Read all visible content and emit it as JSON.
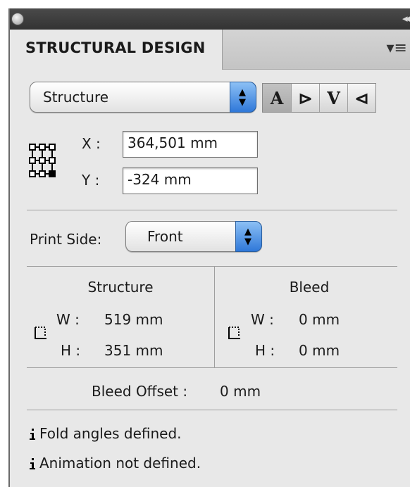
{
  "panel": {
    "tab_title": "STRUCTURAL DESIGN",
    "close_icon": "close-dot-icon",
    "collapse_icon": "double-chevron-right-icon",
    "menu_icon": "panel-menu-icon"
  },
  "structure_select": {
    "value": "Structure"
  },
  "align_buttons": [
    {
      "glyph": "A",
      "name": "align-up",
      "active": true
    },
    {
      "glyph": "⊳",
      "name": "align-right",
      "active": false
    },
    {
      "glyph": "V",
      "name": "align-down",
      "active": false
    },
    {
      "glyph": "⊲",
      "name": "align-left",
      "active": false
    }
  ],
  "position": {
    "x_label": "X :",
    "x_value": "364,501 mm",
    "y_label": "Y :",
    "y_value": "-324 mm",
    "reference_icon": "reference-point-grid-icon"
  },
  "print_side": {
    "label": "Print Side:",
    "value": "Front"
  },
  "structure": {
    "heading": "Structure",
    "w_label": "W :",
    "w_value": "519 mm",
    "h_label": "H :",
    "h_value": "351 mm",
    "icon": "dimension-corner-icon"
  },
  "bleed": {
    "heading": "Bleed",
    "w_label": "W :",
    "w_value": "0 mm",
    "h_label": "H :",
    "h_value": "0 mm",
    "icon": "dimension-corner-icon"
  },
  "bleed_offset": {
    "label": "Bleed Offset :",
    "value": "0 mm"
  },
  "status": [
    {
      "text": "Fold angles defined.",
      "icon": "info-icon"
    },
    {
      "text": "Animation not defined.",
      "icon": "info-icon"
    }
  ]
}
